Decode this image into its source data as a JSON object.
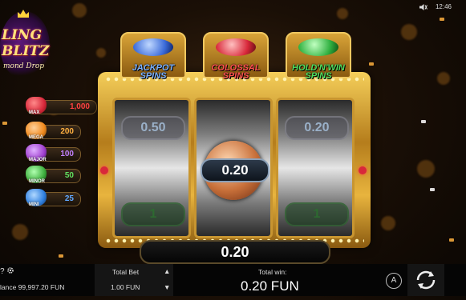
{
  "status": {
    "time": "12:46"
  },
  "logo": {
    "line1": "LING",
    "line2": "BLITZ",
    "line3": "mond Drop"
  },
  "jackpots": [
    {
      "name": "MAX",
      "value": "1,000",
      "color": "#d8283a",
      "textcolor": "#ff4040"
    },
    {
      "name": "MEGA",
      "value": "200",
      "color": "#f08a1e",
      "textcolor": "#ffb040"
    },
    {
      "name": "MAJOR",
      "value": "100",
      "color": "#a040d0",
      "textcolor": "#c080ff"
    },
    {
      "name": "MINOR",
      "value": "50",
      "color": "#40b040",
      "textcolor": "#60e060"
    },
    {
      "name": "MINI",
      "value": "25",
      "color": "#3080e0",
      "textcolor": "#60a8ff"
    }
  ],
  "chests": [
    {
      "label1": "JACKPOT",
      "label2": "SPINS",
      "jewel": "#3a6ad8",
      "text": "#7ab0ff"
    },
    {
      "label1": "COLOSSAL",
      "label2": "SPINS",
      "jewel": "#d8283a",
      "text": "#ff5050"
    },
    {
      "label1": "HOLD'N'WIN",
      "label2": "SPINS",
      "jewel": "#30b040",
      "text": "#50e060"
    }
  ],
  "reels": {
    "top": [
      "0.50",
      "",
      "0.20"
    ],
    "bottom": [
      "1",
      "",
      "1"
    ]
  },
  "center_value": "0.20",
  "win_display": "0.20",
  "bottom": {
    "balance_label": "lance",
    "balance": "99,997.20 FUN",
    "total_bet_label": "Total Bet",
    "total_bet": "1.00 FUN",
    "total_win_label": "Total win:",
    "total_win": "0.20 FUN",
    "autoplay_icon": "A"
  }
}
